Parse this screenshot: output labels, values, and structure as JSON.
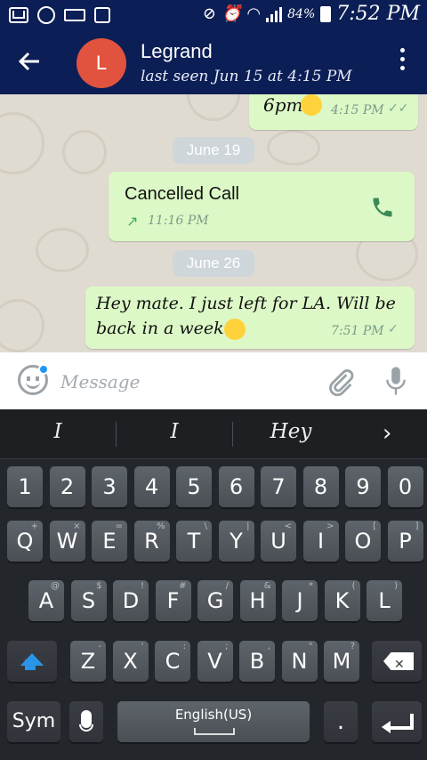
{
  "status_bar": {
    "battery": "84%",
    "time": "7:52 PM"
  },
  "header": {
    "avatar_letter": "L",
    "contact_name": "Legrand",
    "contact_status": "last seen Jun 15 at 4:15 PM",
    "colors": {
      "header_bg": "#0b1e55",
      "avatar_bg": "#e1533f"
    }
  },
  "chat": {
    "messages": [
      {
        "text": "6pm",
        "emoji": "smiling-face-icon",
        "time": "4:15 PM",
        "status": "read"
      },
      {
        "date_label": "June 19"
      },
      {
        "title": "Cancelled Call",
        "time": "11:16 PM",
        "direction": "outgoing"
      },
      {
        "date_label": "June 26"
      },
      {
        "line1": "Hey mate. I just left for LA. Will be",
        "line2": "back in a week",
        "emoji": "smiling-face-icon",
        "time": "7:51 PM",
        "status": "sent"
      }
    ],
    "colors": {
      "bubble_out": "#dcf8c6",
      "wallpaper": "#e0dbd1"
    }
  },
  "input": {
    "placeholder": "Message"
  },
  "keyboard": {
    "suggestions": [
      "I",
      "I",
      "Hey"
    ],
    "number_row": [
      {
        "k": "1"
      },
      {
        "k": "2"
      },
      {
        "k": "3"
      },
      {
        "k": "4"
      },
      {
        "k": "5"
      },
      {
        "k": "6"
      },
      {
        "k": "7"
      },
      {
        "k": "8"
      },
      {
        "k": "9"
      },
      {
        "k": "0"
      }
    ],
    "row1": [
      {
        "k": "Q",
        "s": "+"
      },
      {
        "k": "W",
        "s": "×"
      },
      {
        "k": "E",
        "s": "="
      },
      {
        "k": "R",
        "s": "%"
      },
      {
        "k": "T",
        "s": "\\"
      },
      {
        "k": "Y",
        "s": "|"
      },
      {
        "k": "U",
        "s": "<"
      },
      {
        "k": "I",
        "s": ">"
      },
      {
        "k": "O",
        "s": "["
      },
      {
        "k": "P",
        "s": "]"
      }
    ],
    "row2": [
      {
        "k": "A",
        "s": "@"
      },
      {
        "k": "S",
        "s": "$"
      },
      {
        "k": "D",
        "s": "!"
      },
      {
        "k": "F",
        "s": "#"
      },
      {
        "k": "G",
        "s": "/"
      },
      {
        "k": "H",
        "s": "&"
      },
      {
        "k": "J",
        "s": "*"
      },
      {
        "k": "K",
        "s": "("
      },
      {
        "k": "L",
        "s": ")"
      }
    ],
    "row3": [
      {
        "k": "Z",
        "s": "-"
      },
      {
        "k": "X",
        "s": "'"
      },
      {
        "k": "C",
        "s": ":"
      },
      {
        "k": "V",
        "s": ";"
      },
      {
        "k": "B",
        "s": ","
      },
      {
        "k": "N",
        "s": "\""
      },
      {
        "k": "M",
        "s": "?"
      }
    ],
    "sym_label": "Sym",
    "space_label": "English(US)",
    "period": "."
  }
}
